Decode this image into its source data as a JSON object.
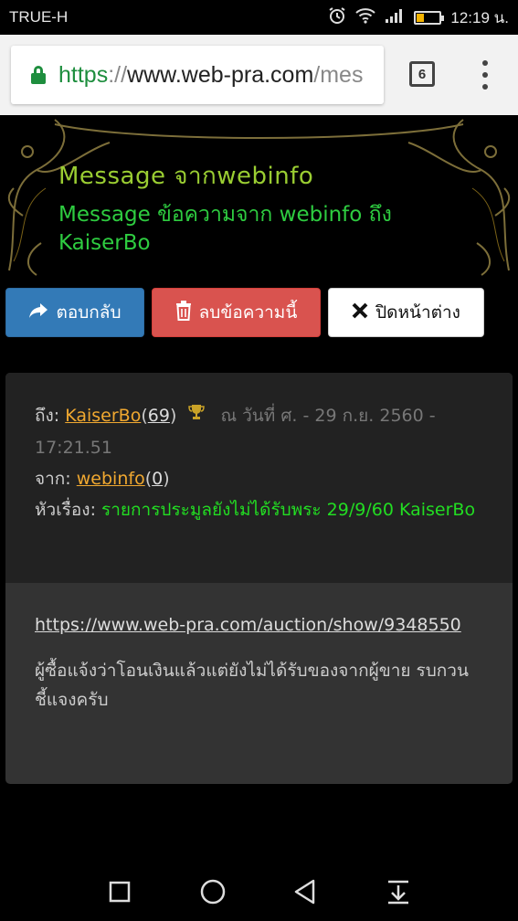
{
  "status_bar": {
    "carrier": "TRUE-H",
    "time": "12:19 น.",
    "battery_level": 0.3
  },
  "browser": {
    "url_scheme": "https",
    "url_sep": "://",
    "url_host": "www.web-pra.com",
    "url_rest": "/mes",
    "tab_count": "6"
  },
  "header": {
    "title": "Message จากwebinfo",
    "subtitle": "Message ข้อความจาก webinfo ถึง KaiserBo"
  },
  "buttons": {
    "reply": "ตอบกลับ",
    "delete": "ลบข้อความนี้",
    "close": "ปิดหน้าต่าง"
  },
  "message": {
    "to_label": "ถึง:",
    "to_user": "KaiserBo",
    "to_count_open": "(",
    "to_count": "69",
    "to_count_close": ")",
    "date_text": "ณ วันที่ ศ. - 29 ก.ย. 2560 - 17:21.51",
    "from_label": "จาก:",
    "from_user": "webinfo",
    "from_count": "0",
    "subject_label": "หัวเรื่อง:",
    "subject": "รายการประมูลยังไม่ได้รับพระ 29/9/60 KaiserBo",
    "link": "https://www.web-pra.com/auction/show/9348550",
    "body": "ผู้ซื้อแจ้งว่าโอนเงินแล้วแต่ยังไม่ได้รับของจากผู้ขาย รบกวนชี้แจงครับ"
  },
  "colors": {
    "title": "#9acd32",
    "subtitle": "#2ecc40",
    "reply_btn": "#337ab7",
    "delete_btn": "#d9534f",
    "user_link": "#f0a830",
    "subject": "#22dd22"
  },
  "icons": {
    "reply": "share-arrow-icon",
    "delete": "trash-icon",
    "close": "x-icon",
    "trophy": "trophy-icon"
  }
}
